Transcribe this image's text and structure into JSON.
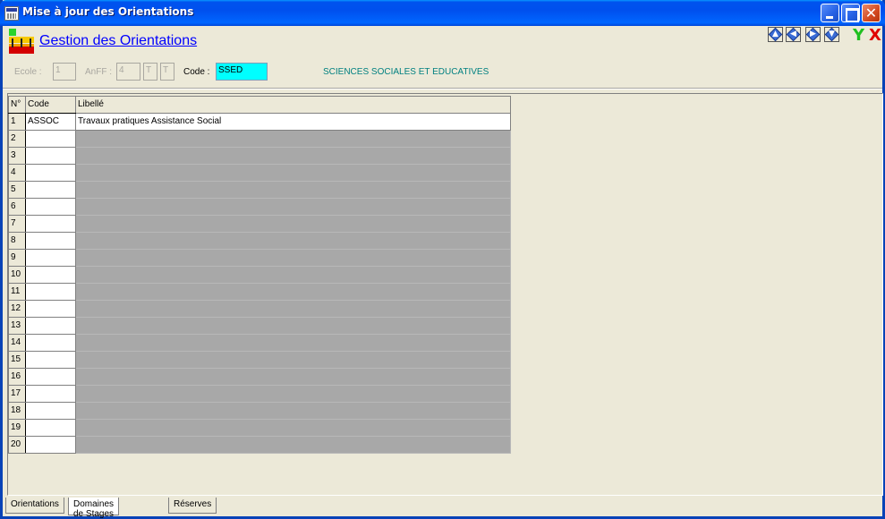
{
  "window": {
    "title": "Mise à jour des Orientations"
  },
  "header": {
    "title": "Gestion des Orientations"
  },
  "form": {
    "ecole_label": "Ecole :",
    "ecole_value": "1",
    "anff_label": "AnFF :",
    "anff_value": "4",
    "anff_t1": "T",
    "anff_t2": "T",
    "code_label": "Code :",
    "code_value": "SSED",
    "code_description": "SCIENCES SOCIALES ET EDUCATIVES"
  },
  "grid": {
    "headers": [
      "N°",
      "Code",
      "Libellé"
    ],
    "rows": [
      {
        "n": "1",
        "code": "ASSOC",
        "libelle": "Travaux pratiques Assistance Social"
      },
      {
        "n": "2",
        "code": "",
        "libelle": ""
      },
      {
        "n": "3",
        "code": "",
        "libelle": ""
      },
      {
        "n": "4",
        "code": "",
        "libelle": ""
      },
      {
        "n": "5",
        "code": "",
        "libelle": ""
      },
      {
        "n": "6",
        "code": "",
        "libelle": ""
      },
      {
        "n": "7",
        "code": "",
        "libelle": ""
      },
      {
        "n": "8",
        "code": "",
        "libelle": ""
      },
      {
        "n": "9",
        "code": "",
        "libelle": ""
      },
      {
        "n": "10",
        "code": "",
        "libelle": ""
      },
      {
        "n": "11",
        "code": "",
        "libelle": ""
      },
      {
        "n": "12",
        "code": "",
        "libelle": ""
      },
      {
        "n": "13",
        "code": "",
        "libelle": ""
      },
      {
        "n": "14",
        "code": "",
        "libelle": ""
      },
      {
        "n": "15",
        "code": "",
        "libelle": ""
      },
      {
        "n": "16",
        "code": "",
        "libelle": ""
      },
      {
        "n": "17",
        "code": "",
        "libelle": ""
      },
      {
        "n": "18",
        "code": "",
        "libelle": ""
      },
      {
        "n": "19",
        "code": "",
        "libelle": ""
      },
      {
        "n": "20",
        "code": "",
        "libelle": ""
      }
    ]
  },
  "tabs": [
    {
      "label": "Orientations",
      "active": false
    },
    {
      "label": "Domaines de Stages",
      "active": true
    },
    {
      "label": "Réserves",
      "active": false
    }
  ],
  "icons": {
    "nav": [
      "arrow-up-icon",
      "arrow-left-icon",
      "arrow-right-icon",
      "arrow-down-icon"
    ],
    "ok": "check-icon",
    "cancel": "x-icon"
  },
  "glyphs": {
    "ok": "Y",
    "cancel": "X",
    "close": "✕"
  }
}
